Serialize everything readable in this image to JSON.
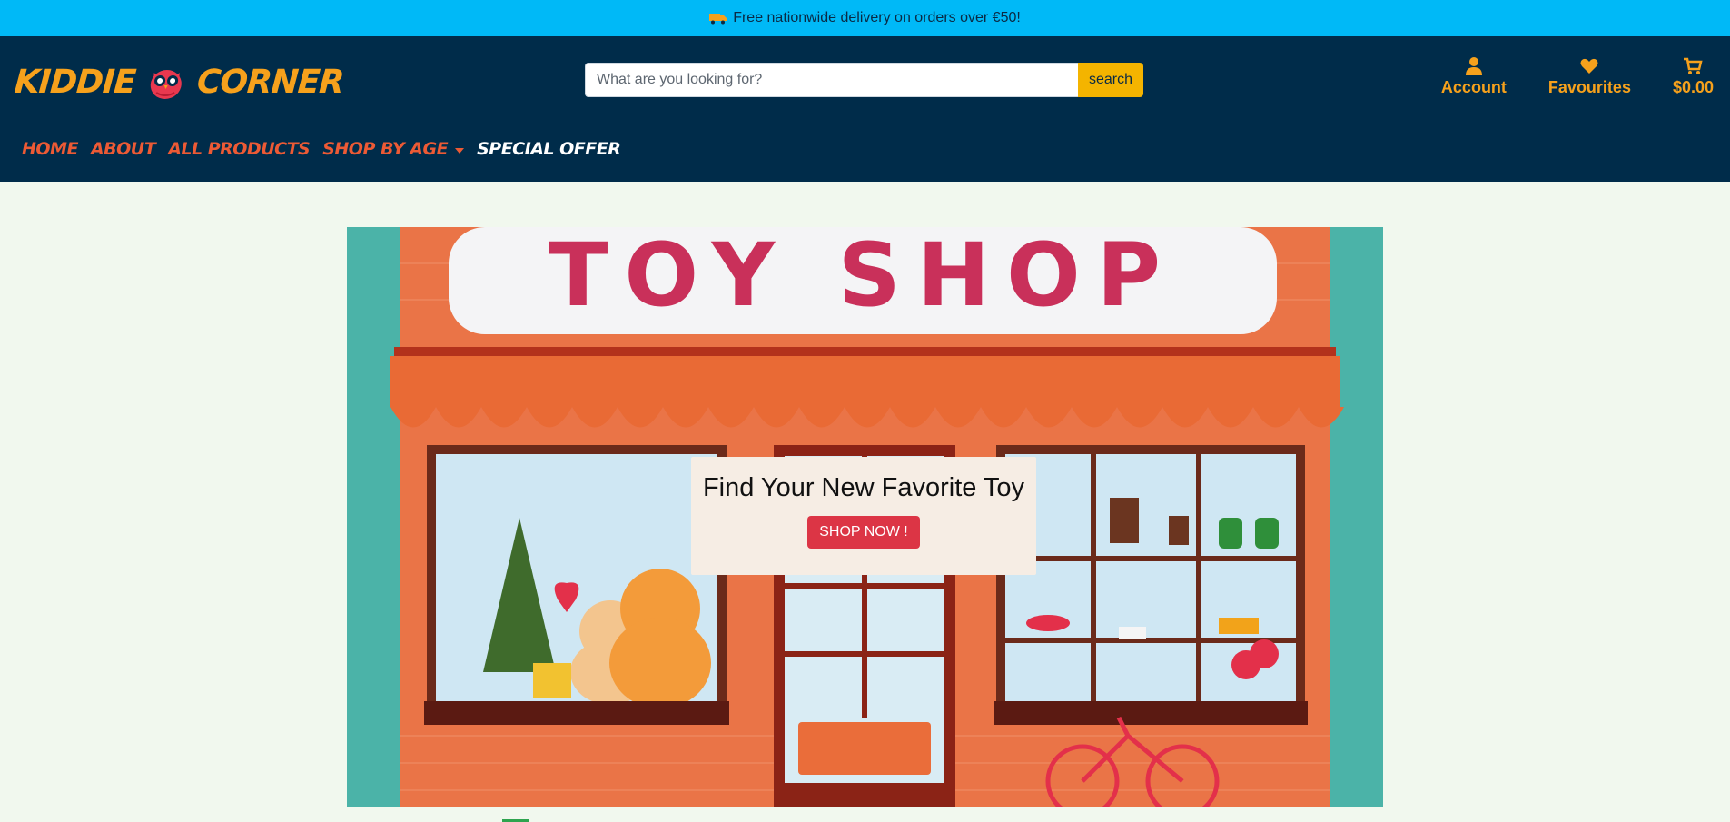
{
  "announcement": {
    "text": "Free nationwide delivery on orders over €50!",
    "icon": "truck-icon"
  },
  "brand": {
    "name_left": "KIDDIE",
    "name_right": "CORNER",
    "logo_icon": "owl-icon"
  },
  "search": {
    "placeholder": "What are you looking for?",
    "value": "",
    "button_label": "search"
  },
  "utilities": [
    {
      "label": "Account",
      "icon": "user-icon"
    },
    {
      "label": "Favourites",
      "icon": "heart-icon"
    },
    {
      "label": "$0.00",
      "icon": "cart-icon"
    }
  ],
  "nav": {
    "items": [
      {
        "label": "HOME"
      },
      {
        "label": "ABOUT"
      },
      {
        "label": "ALL PRODUCTS"
      },
      {
        "label": "SHOP BY AGE"
      },
      {
        "label": "SPECIAL OFFER"
      }
    ]
  },
  "hero": {
    "sign_text": "TOY SHOP",
    "headline": "Find Your New Favorite Toy",
    "cta_label": "SHOP NOW !"
  },
  "colors": {
    "announcement_bg": "#00b9f7",
    "header_bg": "#002c4a",
    "accent_orange": "#f6a11c",
    "nav_link": "#ec5a35",
    "cta_red": "#dc3545",
    "page_bg": "#f1f8ee"
  }
}
